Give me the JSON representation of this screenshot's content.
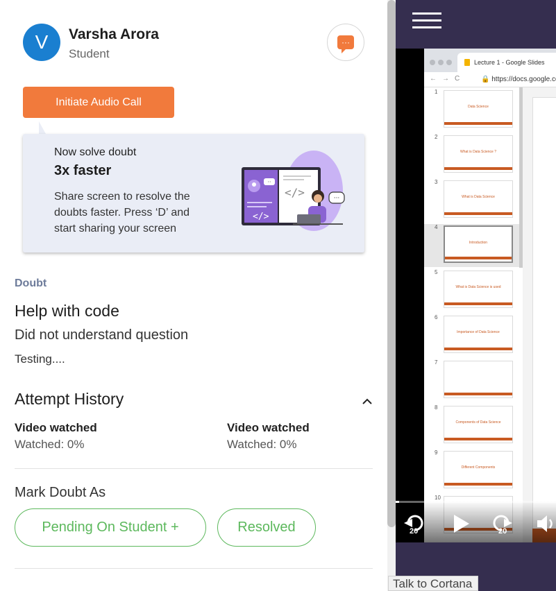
{
  "user": {
    "initial": "V",
    "name": "Varsha Arora",
    "role": "Student"
  },
  "actions": {
    "audio_call_label": "Initiate Audio Call",
    "chat_glyph": "···"
  },
  "tip": {
    "line1": "Now solve doubt",
    "line2": "3x faster",
    "body": "Share screen to resolve the doubts faster. Press ‘D’ and start sharing your screen"
  },
  "doubt": {
    "section_label": "Doubt",
    "title": "Help with code",
    "subtitle": "Did not understand question",
    "description": "Testing...."
  },
  "attempt_history": {
    "title": "Attempt History",
    "items": [
      {
        "title": "Video watched",
        "value": "Watched: 0%"
      },
      {
        "title": "Video watched",
        "value": "Watched: 0%"
      }
    ]
  },
  "mark": {
    "title": "Mark Doubt As",
    "pending_label": "Pending On Student  +",
    "resolved_label": "Resolved"
  },
  "video": {
    "browser_tab": "Lecture 1 - Google Slides",
    "url": "https://docs.google.co",
    "slides": [
      {
        "num": "1",
        "title": "Data Science"
      },
      {
        "num": "2",
        "title": "What is Data Science ?"
      },
      {
        "num": "3",
        "title": "What is Data Science"
      },
      {
        "num": "4",
        "title": "Introduction"
      },
      {
        "num": "5",
        "title": "What is Data Science is used"
      },
      {
        "num": "6",
        "title": "Importance of Data Science"
      },
      {
        "num": "7",
        "title": ""
      },
      {
        "num": "8",
        "title": "Components of Data Science"
      },
      {
        "num": "9",
        "title": "Different Components"
      },
      {
        "num": "10",
        "title": ""
      }
    ],
    "selected_slide": "4",
    "rewind_label": "20",
    "forward_label": "20",
    "progress": 0.02
  },
  "taskbar": {
    "cortana_label": "Talk to Cortana"
  },
  "colors": {
    "accent": "#f17a3c",
    "success": "#5cb85c",
    "panel_dark": "#352e4f",
    "link_blue": "#1a7fd0"
  }
}
